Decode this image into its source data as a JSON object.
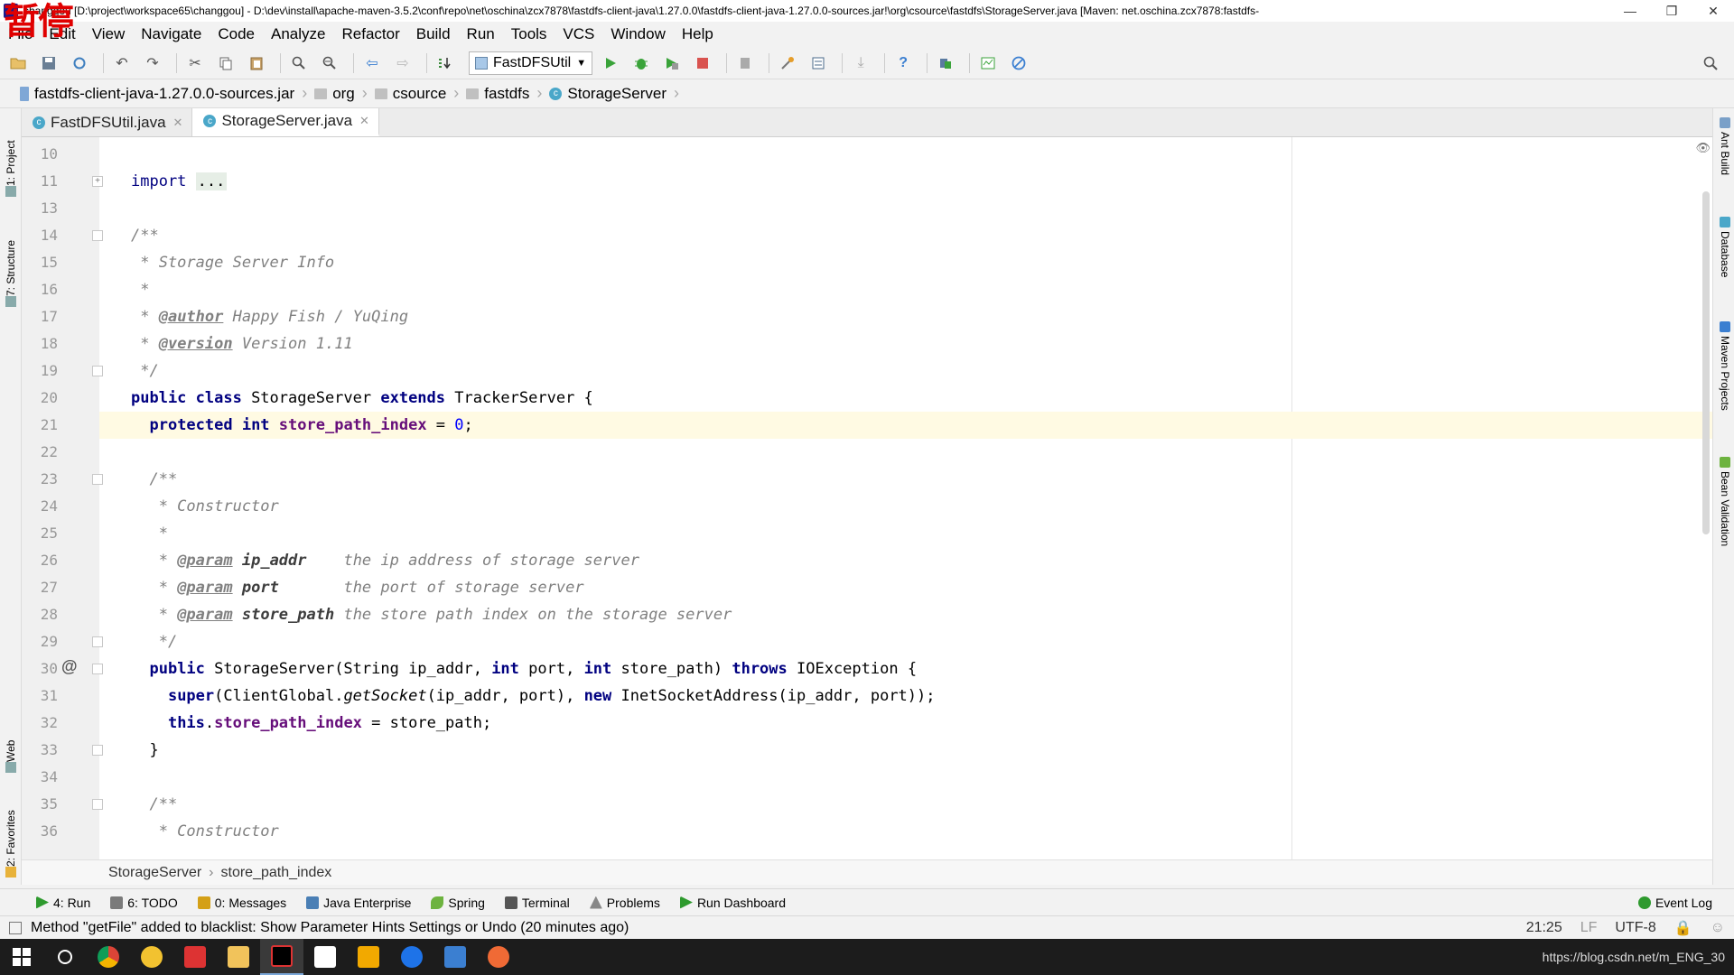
{
  "overlay": {
    "pause_text": "暂停"
  },
  "titlebar": {
    "title": "changgou [D:\\project\\workspace65\\changgou] - D:\\dev\\install\\apache-maven-3.5.2\\conf\\repo\\net\\oschina\\zcx7878\\fastdfs-client-java\\1.27.0.0\\fastdfs-client-java-1.27.0.0-sources.jar!\\org\\csource\\fastdfs\\StorageServer.java [Maven: net.oschina.zcx7878:fastdfs-",
    "minimize": "—",
    "restore": "❐",
    "close": "✕"
  },
  "menubar": {
    "items": [
      "File",
      "Edit",
      "View",
      "Navigate",
      "Code",
      "Analyze",
      "Refactor",
      "Build",
      "Run",
      "Tools",
      "VCS",
      "Window",
      "Help"
    ]
  },
  "toolbar": {
    "run_config": "FastDFSUtil"
  },
  "navbar": {
    "crumbs": [
      "fastdfs-client-java-1.27.0.0-sources.jar",
      "org",
      "csource",
      "fastdfs",
      "StorageServer"
    ]
  },
  "left_strip": {
    "tabs": [
      "1: Project",
      "7: Structure",
      "Web",
      "2: Favorites"
    ]
  },
  "right_strip": {
    "tabs": [
      "Ant Build",
      "Database",
      "Maven Projects",
      "Bean Validation"
    ]
  },
  "editor_tabs": [
    {
      "label": "FastDFSUtil.java",
      "active": false
    },
    {
      "label": "StorageServer.java",
      "active": true
    }
  ],
  "code": {
    "line_numbers": [
      "10",
      "11",
      "13",
      "14",
      "15",
      "16",
      "17",
      "18",
      "19",
      "20",
      "21",
      "22",
      "23",
      "24",
      "25",
      "26",
      "27",
      "28",
      "29",
      "30",
      "31",
      "32",
      "33",
      "34",
      "35",
      "36"
    ],
    "current_line": "21"
  },
  "code_breadcrumb": {
    "class_name": "StorageServer",
    "member": "store_path_index"
  },
  "bottom_tools": [
    {
      "label": "4: Run",
      "color": "#2e9a2e"
    },
    {
      "label": "6: TODO",
      "color": "#7a7a7a"
    },
    {
      "label": "0: Messages",
      "color": "#d4a017"
    },
    {
      "label": "Java Enterprise",
      "color": "#4a7fb5"
    },
    {
      "label": "Spring",
      "color": "#6db33f"
    },
    {
      "label": "Terminal",
      "color": "#555555"
    },
    {
      "label": "Problems",
      "color": "#888888"
    },
    {
      "label": "Run Dashboard",
      "color": "#2e9a2e"
    },
    {
      "label": "Event Log",
      "color": "#2e9a2e"
    }
  ],
  "statusbar": {
    "message": "Method \"getFile\" added to blacklist: Show Parameter Hints Settings or Undo (20 minutes ago)",
    "position": "21:25",
    "line_sep": "LF",
    "encoding": "UTF-8"
  },
  "taskbar": {
    "tray_text": "https://blog.csdn.net/m_ENG_30"
  }
}
